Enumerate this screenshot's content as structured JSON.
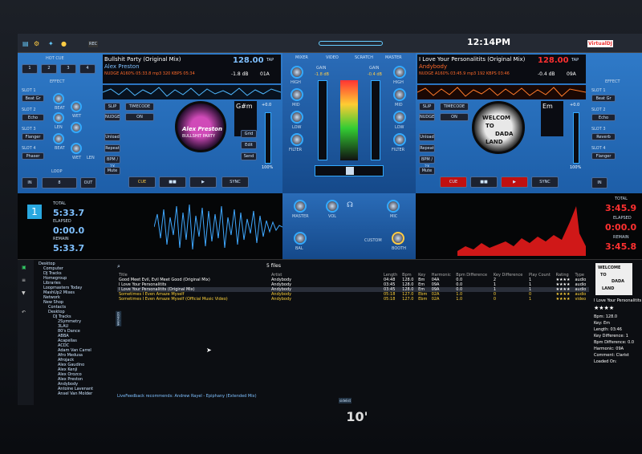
{
  "topbar": {
    "time": "12:14PM",
    "brand": "VirtualDJ",
    "rec": "REC"
  },
  "left_panel": {
    "hot_cue": "HOT CUE",
    "hot_cue_nums": [
      "1",
      "2",
      "3",
      "4"
    ],
    "effect": "EFFECT",
    "slots": [
      {
        "label": "SLOT 1",
        "value": "Beat Gr"
      },
      {
        "label": "SLOT 2",
        "value": "Echo"
      },
      {
        "label": "SLOT 3",
        "value": "Flanger"
      },
      {
        "label": "SLOT 4",
        "value": "Phaser"
      }
    ],
    "knob_labels": [
      "BEAT",
      "WET",
      "LEN",
      "BEAT",
      "WET",
      "LEN"
    ],
    "loop": "LOOP",
    "loop_in": "IN",
    "loop_value": "8",
    "loop_out": "OUT"
  },
  "deck1": {
    "title": "Bullshit Party (Original Mix)",
    "artist": "Alex Preston",
    "bpm": "128.00",
    "tap": "TAP",
    "info": "NUDGE A160% 05:33.8 mp3 320 KBPS 05:34",
    "pitch": "-1.8 dB",
    "key_code": "01A",
    "key": "G#m",
    "gain": "+0.0",
    "pitch_pct": "100%",
    "art_text": "Alex Preston",
    "art_sub": "BULLSHIT PARTY",
    "cue": "CUE",
    "play": "▶",
    "pause": "■■",
    "sync": "SYNC",
    "slip": "SLIP",
    "nudge": "NUDGE",
    "timecode": "TIMECODE",
    "on": "ON",
    "unload": "Unload",
    "repeat": "Repeat",
    "bpm_btn": "BPM / 2X",
    "mute": "Mute",
    "grid": "Grid",
    "edit": "Edit",
    "send": "Send"
  },
  "mixer": {
    "tabs": [
      "MIXER",
      "VIDEO",
      "SCRATCH",
      "MASTER"
    ],
    "gain": "GAIN",
    "high": "HIGH",
    "mid": "MID",
    "low": "LOW",
    "filter": "FILTER",
    "g1": "-1.8 dB",
    "g2": "-0.4 dB",
    "master": "MASTER",
    "vol": "VOL",
    "custom": "CUSTOM",
    "mic": "MIC",
    "bal": "BAL",
    "booth": "BOOTH"
  },
  "deck2": {
    "title": "I Love Your Personalitits (Original Mix)",
    "artist": "Andybody",
    "bpm": "128.00",
    "tap": "TAP",
    "info": "NUDGE A160% 03:45.9 mp3 192 KBPS 03:46",
    "pitch": "-0.4 dB",
    "key_code": "09A",
    "key": "Em",
    "gain": "+0.0",
    "pitch_pct": "100%",
    "art_lines": [
      "WELCOM",
      "TO",
      "DADA",
      "LAND"
    ],
    "cue": "CUE",
    "play": "▶",
    "pause": "■■",
    "sync": "SYNC",
    "slip": "SLIP",
    "nudge": "NUDGE",
    "timecode": "TIMECODE",
    "on": "ON",
    "unload": "Unload",
    "repeat": "Repeat",
    "bpm_btn": "BPM / 2X",
    "mute": "Mute"
  },
  "right_panel": {
    "effect": "EFFECT",
    "slots": [
      {
        "label": "SLOT 1",
        "value": "Beat Gr"
      },
      {
        "label": "SLOT 2",
        "value": "Echo"
      },
      {
        "label": "SLOT 3",
        "value": "Reverb"
      },
      {
        "label": "SLOT 4",
        "value": "Flanger"
      }
    ],
    "loop_in": "IN"
  },
  "time_left": {
    "total_label": "TOTAL",
    "total": "5:33.7",
    "elapsed_label": "ELAPSED",
    "elapsed": "0:00.0",
    "remain_label": "REMAIN",
    "remain": "5:33.7",
    "deck_num": "1"
  },
  "time_right": {
    "total_label": "TOTAL",
    "total": "3:45.9",
    "elapsed_label": "ELAPSED",
    "elapsed": "0:00.0",
    "remain_label": "REMAIN",
    "remain": "3:45.8"
  },
  "browser": {
    "file_count": "5 files",
    "headers": [
      "Title",
      "Artist",
      "Length",
      "Bpm",
      "Key",
      "Harmonic",
      "Bpm Difference",
      "Key Difference",
      "Play Count",
      "Rating",
      "Type"
    ],
    "rows": [
      [
        "Good Meet Evil, Evil Meet Good (Original Mix)",
        "Andybody",
        "04:48",
        "128.0",
        "Bm",
        "04A",
        "0.0",
        "2",
        "1",
        "★★★★",
        "audio"
      ],
      [
        "I Love Your Personalitits",
        "Andybody",
        "03:45",
        "128.0",
        "Em",
        "09A",
        "0.0",
        "1",
        "1",
        "★★★★",
        "audio"
      ],
      [
        "I Love Your Personalitits (Original Mix)",
        "Andybody",
        "03:45",
        "128.0",
        "Em",
        "09A",
        "0.0",
        "1",
        "1",
        "★★★★",
        "audio"
      ],
      [
        "Sometimes I Even Amaze Myself",
        "Andybody",
        "05:18",
        "127.0",
        "Ebm",
        "02A",
        "1.0",
        "0",
        "0",
        "★★★★",
        "audio"
      ],
      [
        "Sometimes I Even Amaze Myself (Official Music Video)",
        "Andybody",
        "05:18",
        "127.0",
        "Ebm",
        "02A",
        "1.0",
        "0",
        "1",
        "★★★★",
        "video"
      ]
    ],
    "footer": "LiveFeedback recommends:  Andrew Rayel - Epiphany (Extended Mix)",
    "sideview": "sideview",
    "sidelist": "sidelist"
  },
  "folders": [
    "Desktop",
    "Computer",
    "DJ Tracks",
    "Homegroup",
    "Libraries",
    "Loopmasters Today",
    "MashUp2 Mixes",
    "Network",
    "New Shop",
    "Contacts",
    "Desktop",
    "DJ Tracks",
    "2Symmetry",
    "3LAU",
    "80's Dance",
    "ABBA",
    "Acapellas",
    "ACDC",
    "Adam Van Carrel",
    "Afro Medusa",
    "Afrojack",
    "Alex Gaudino",
    "Alex Kenji",
    "Alex Orozco",
    "Alex Preston",
    "Andybody",
    "Antoine Lavenant",
    "Ansel Van Molder"
  ],
  "info_panel": {
    "art_lines": [
      "WELCOME",
      "TO",
      "DADA",
      "LAND"
    ],
    "title": "I Love Your Personalitits (Original Mix)",
    "stars": "★★★★",
    "bpm": "Bpm: 128.0",
    "key": "Key: Em",
    "length": "Length: 03:46",
    "key_diff": "Key Difference: 1",
    "bpm_diff": "Bpm Difference: 0.0",
    "harmonic": "Harmonic: 09A",
    "comment": "Comment: Clarist",
    "loaded": "Loaded On:"
  },
  "monitor_brand": "10'"
}
